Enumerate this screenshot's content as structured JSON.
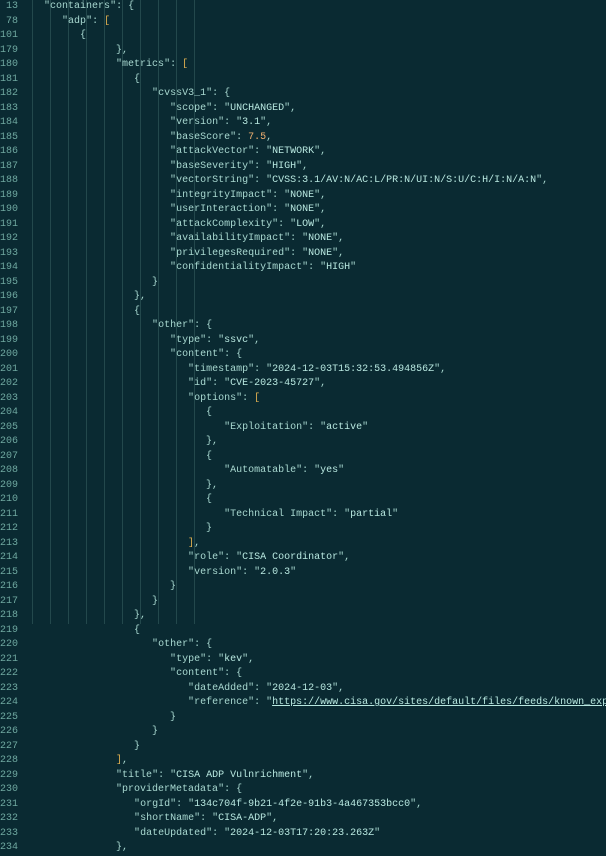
{
  "gutter": [
    "13",
    "78",
    "101",
    "179",
    "180",
    "181",
    "182",
    "183",
    "184",
    "185",
    "186",
    "187",
    "188",
    "189",
    "190",
    "191",
    "192",
    "193",
    "194",
    "195",
    "196",
    "197",
    "198",
    "199",
    "200",
    "201",
    "202",
    "203",
    "204",
    "205",
    "206",
    "207",
    "208",
    "209",
    "210",
    "211",
    "212",
    "213",
    "214",
    "215",
    "216",
    "217",
    "218",
    "219",
    "220",
    "221",
    "222",
    "223",
    "224",
    "225",
    "226",
    "227",
    "228",
    "229",
    "230",
    "231",
    "232",
    "233",
    "234"
  ],
  "top": {
    "k1": "containers",
    "k2": "adp"
  },
  "metrics_key": "metrics",
  "cvss": {
    "key": "cvssV3_1",
    "scope_k": "scope",
    "scope_v": "UNCHANGED",
    "version_k": "version",
    "version_v": "3.1",
    "baseScore_k": "baseScore",
    "baseScore_v": "7.5",
    "attackVector_k": "attackVector",
    "attackVector_v": "NETWORK",
    "baseSeverity_k": "baseSeverity",
    "baseSeverity_v": "HIGH",
    "vectorString_k": "vectorString",
    "vectorString_v": "CVSS:3.1/AV:N/AC:L/PR:N/UI:N/S:U/C:H/I:N/A:N",
    "integrityImpact_k": "integrityImpact",
    "integrityImpact_v": "NONE",
    "userInteraction_k": "userInteraction",
    "userInteraction_v": "NONE",
    "attackComplexity_k": "attackComplexity",
    "attackComplexity_v": "LOW",
    "availabilityImpact_k": "availabilityImpact",
    "availabilityImpact_v": "NONE",
    "privilegesRequired_k": "privilegesRequired",
    "privilegesRequired_v": "NONE",
    "confidentialityImpact_k": "confidentialityImpact",
    "confidentialityImpact_v": "HIGH"
  },
  "other1": {
    "other_k": "other",
    "type_k": "type",
    "type_v": "ssvc",
    "content_k": "content",
    "timestamp_k": "timestamp",
    "timestamp_v": "2024-12-03T15:32:53.494856Z",
    "id_k": "id",
    "id_v": "CVE-2023-45727",
    "options_k": "options",
    "opt1_k": "Exploitation",
    "opt1_v": "active",
    "opt2_k": "Automatable",
    "opt2_v": "yes",
    "opt3_k": "Technical Impact",
    "opt3_v": "partial",
    "role_k": "role",
    "role_v": "CISA Coordinator",
    "version_k": "version",
    "version_v": "2.0.3"
  },
  "other2": {
    "other_k": "other",
    "type_k": "type",
    "type_v": "kev",
    "content_k": "content",
    "dateAdded_k": "dateAdded",
    "dateAdded_v": "2024-12-03",
    "reference_k": "reference",
    "reference_v": "https://www.cisa.gov/sites/default/files/feeds/known_exploited_vulnerabilities.json"
  },
  "tail": {
    "title_k": "title",
    "title_v": "CISA ADP Vulnrichment",
    "pm_k": "providerMetadata",
    "orgId_k": "orgId",
    "orgId_v": "134c704f-9b21-4f2e-91b3-4a467353bcc0",
    "shortName_k": "shortName",
    "shortName_v": "CISA-ADP",
    "dateUpdated_k": "dateUpdated",
    "dateUpdated_v": "2024-12-03T17:20:23.263Z"
  }
}
